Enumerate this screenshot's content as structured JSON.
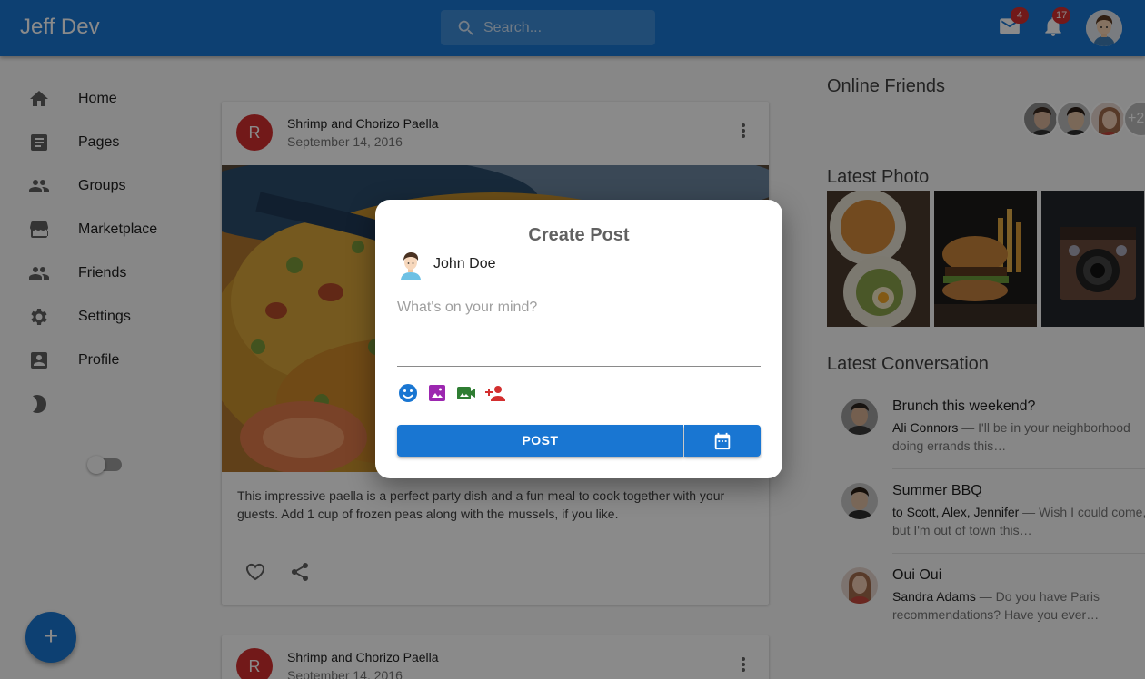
{
  "app": {
    "title": "Jeff Dev"
  },
  "search": {
    "placeholder": "Search..."
  },
  "header": {
    "mail_badge": "4",
    "notifications_badge": "17",
    "colors": {
      "appbar": "#1976d2",
      "badge": "#d32f2f"
    }
  },
  "sidebar": {
    "items": [
      {
        "label": "Home",
        "icon": "home-icon"
      },
      {
        "label": "Pages",
        "icon": "pages-icon"
      },
      {
        "label": "Groups",
        "icon": "groups-icon"
      },
      {
        "label": "Marketplace",
        "icon": "store-icon"
      },
      {
        "label": "Friends",
        "icon": "friends-icon"
      },
      {
        "label": "Settings",
        "icon": "gear-icon"
      },
      {
        "label": "Profile",
        "icon": "profile-icon"
      }
    ],
    "dark_mode": {
      "icon": "moon-icon",
      "enabled": false
    }
  },
  "fab": {
    "label": "+"
  },
  "feed": {
    "posts": [
      {
        "avatar_letter": "R",
        "title": "Shrimp and Chorizo Paella",
        "date": "September 14, 2016",
        "body": "This impressive paella is a perfect party dish and a fun meal to cook together with your guests. Add 1 cup of frozen peas along with the mussels, if you like."
      },
      {
        "avatar_letter": "R",
        "title": "Shrimp and Chorizo Paella",
        "date": "September 14, 2016"
      }
    ]
  },
  "right": {
    "online_friends_title": "Online Friends",
    "online_friends_more": "+2",
    "latest_photo_title": "Latest Photo",
    "latest_conversation_title": "Latest Conversation",
    "conversations": [
      {
        "title": "Brunch this weekend?",
        "from": "Ali Connors",
        "snippet": " — I'll be in your neighborhood doing errands this…"
      },
      {
        "title": "Summer BBQ",
        "from": "to Scott, Alex, Jennifer",
        "snippet": " — Wish I could come, but I'm out of town this…"
      },
      {
        "title": "Oui Oui",
        "from": "Sandra Adams",
        "snippet": " — Do you have Paris recommendations? Have you ever…"
      }
    ]
  },
  "dialog": {
    "title": "Create Post",
    "user_name": "John Doe",
    "placeholder": "What's on your mind?",
    "post_label": "POST",
    "tools": [
      "emoji-icon",
      "image-icon",
      "video-icon",
      "tag-person-icon"
    ],
    "tool_colors": {
      "emoji": "#1976d2",
      "image": "#9c27b0",
      "video": "#2e7d32",
      "person": "#d32f2f"
    }
  }
}
